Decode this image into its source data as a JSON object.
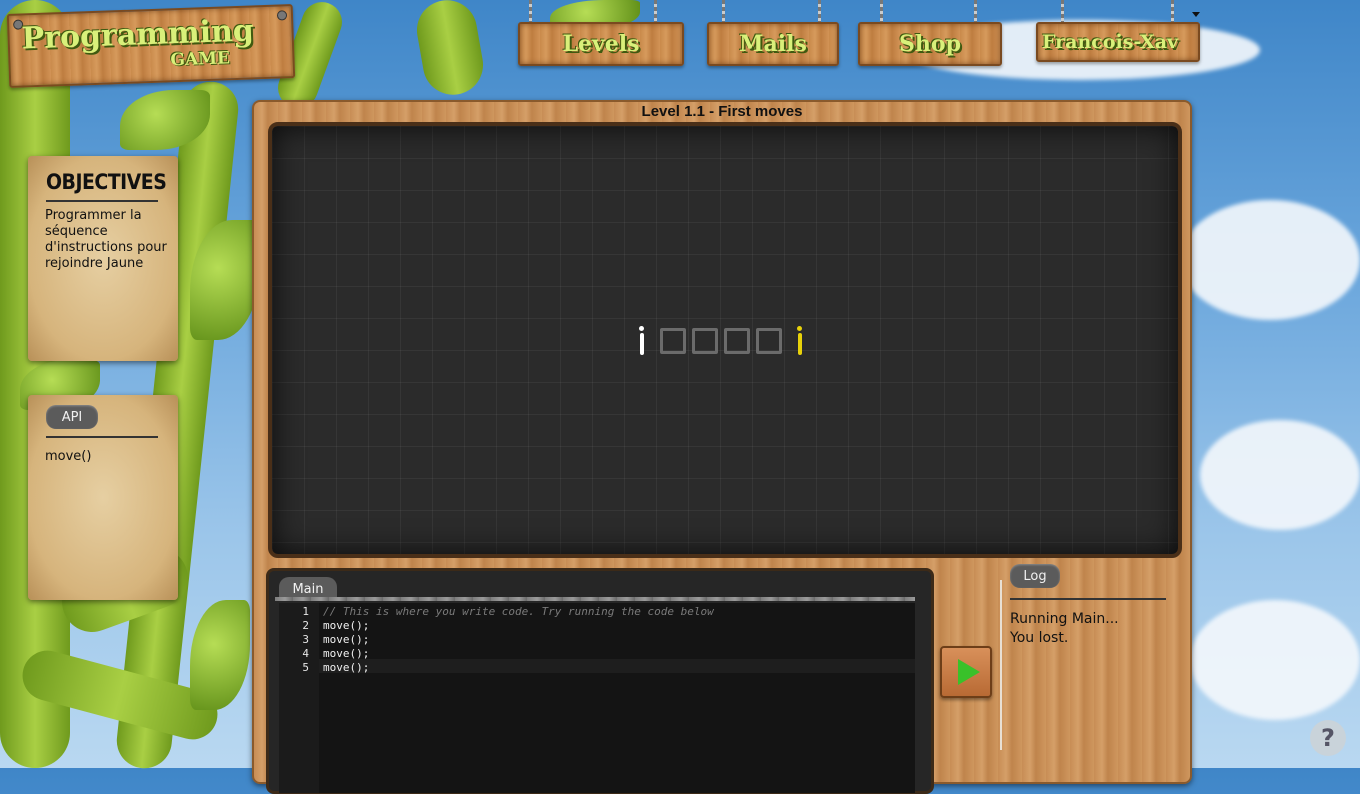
{
  "logo": {
    "line1": "Programming",
    "line2": "GAME"
  },
  "nav": {
    "levels": "Levels",
    "mails": "Mails",
    "shop": "Shop",
    "user": "Francois-Xav",
    "user_dropdown_icon": "caret-down-icon"
  },
  "objectives": {
    "title": "OBJECTIVES",
    "text": "Programmer la séquence d'instructions pour rejoindre Jaune"
  },
  "api": {
    "tab": "API",
    "items": [
      "move()"
    ]
  },
  "level": {
    "title": "Level 1.1 - First moves"
  },
  "board": {
    "cells": 4,
    "player_color": "#ffffff",
    "target_color": "#e8d20a",
    "cell_color": "#6b6b6b"
  },
  "editor": {
    "tab": "Main",
    "lines": [
      {
        "n": "1",
        "text": "// This is where you write code. Try running the code below"
      },
      {
        "n": "2",
        "text": "move();"
      },
      {
        "n": "3",
        "text": "move();"
      },
      {
        "n": "4",
        "text": "move();"
      },
      {
        "n": "5",
        "text": "move();"
      }
    ]
  },
  "run_button": {
    "icon": "play-icon",
    "color": "#39c12a"
  },
  "log": {
    "tab": "Log",
    "lines": [
      "Running Main...",
      "You lost."
    ]
  },
  "help": {
    "icon": "help-icon",
    "glyph": "?"
  }
}
